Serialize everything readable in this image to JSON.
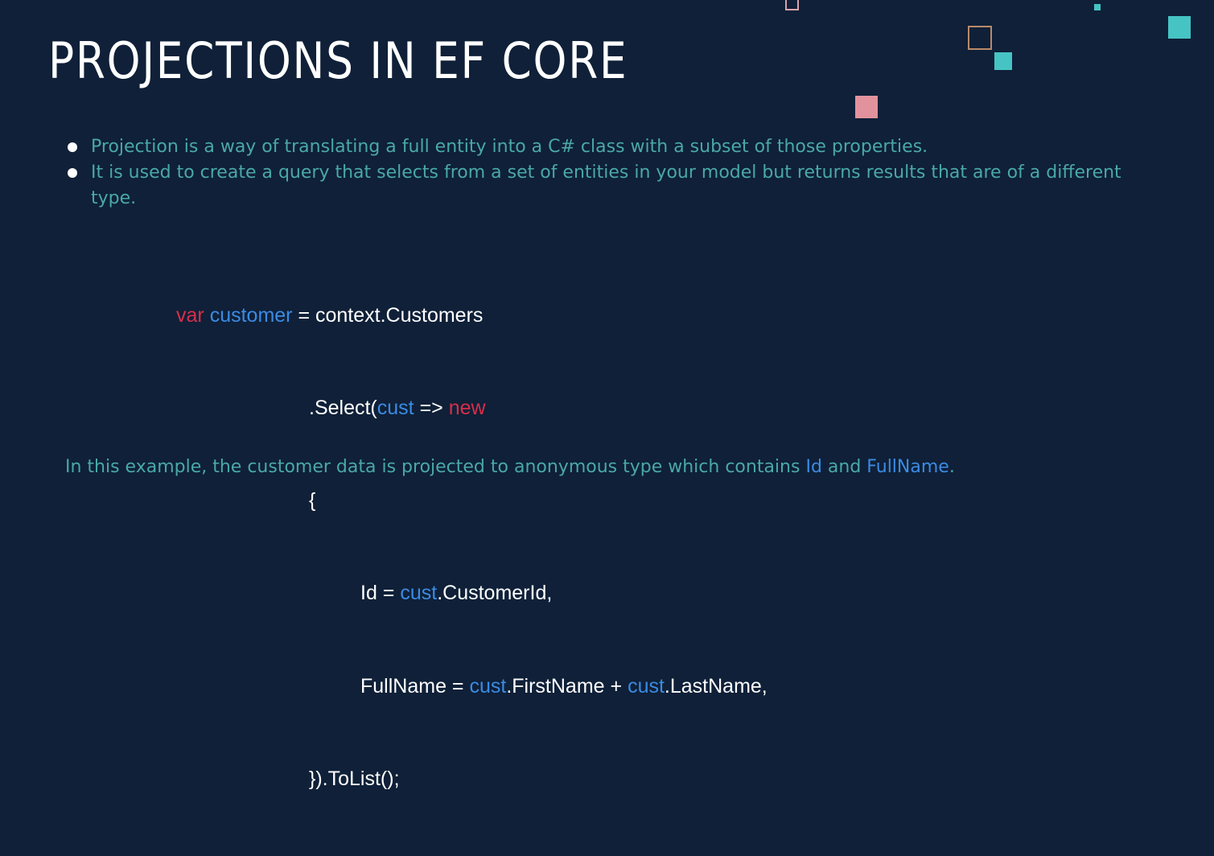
{
  "slide": {
    "title": "PROJECTIONS IN EF CORE",
    "bullets": [
      "Projection is a way of translating a full entity into a C# class with a subset of those properties.",
      "It is used to create a query that selects from a set of entities in your model but returns results that are of a different type."
    ],
    "code": {
      "line1": {
        "kw_var": "var",
        "customer": "customer",
        "rest": " = context.Customers"
      },
      "line2": {
        "pre": ".Select(",
        "cust": "cust",
        "arrow": " => ",
        "kw_new": "new"
      },
      "line3": {
        "text": "{"
      },
      "line4": {
        "pre": "Id = ",
        "cust": "cust",
        "post": ".CustomerId,"
      },
      "line5": {
        "pre": "FullName = ",
        "cust1": "cust",
        "mid": ".FirstName + ",
        "cust2": "cust",
        "post": ".LastName,"
      },
      "line6": {
        "text": "}).ToList();"
      }
    },
    "footer": {
      "prefix": "In this example, the customer data is projected to anonymous type which contains ",
      "id": "Id",
      "and": " and ",
      "fullname": "FullName",
      "suffix": "."
    }
  },
  "colors": {
    "background": "#0f2038",
    "title": "#ffffff",
    "bullet_text": "#4aa8a6",
    "keyword": "#d62f4a",
    "identifier": "#3b8be3",
    "deco_teal": "#46c4c4",
    "deco_pink": "#e2929d",
    "deco_outline_tan": "#b88a6a",
    "deco_outline_pink": "#d9a3ad"
  }
}
